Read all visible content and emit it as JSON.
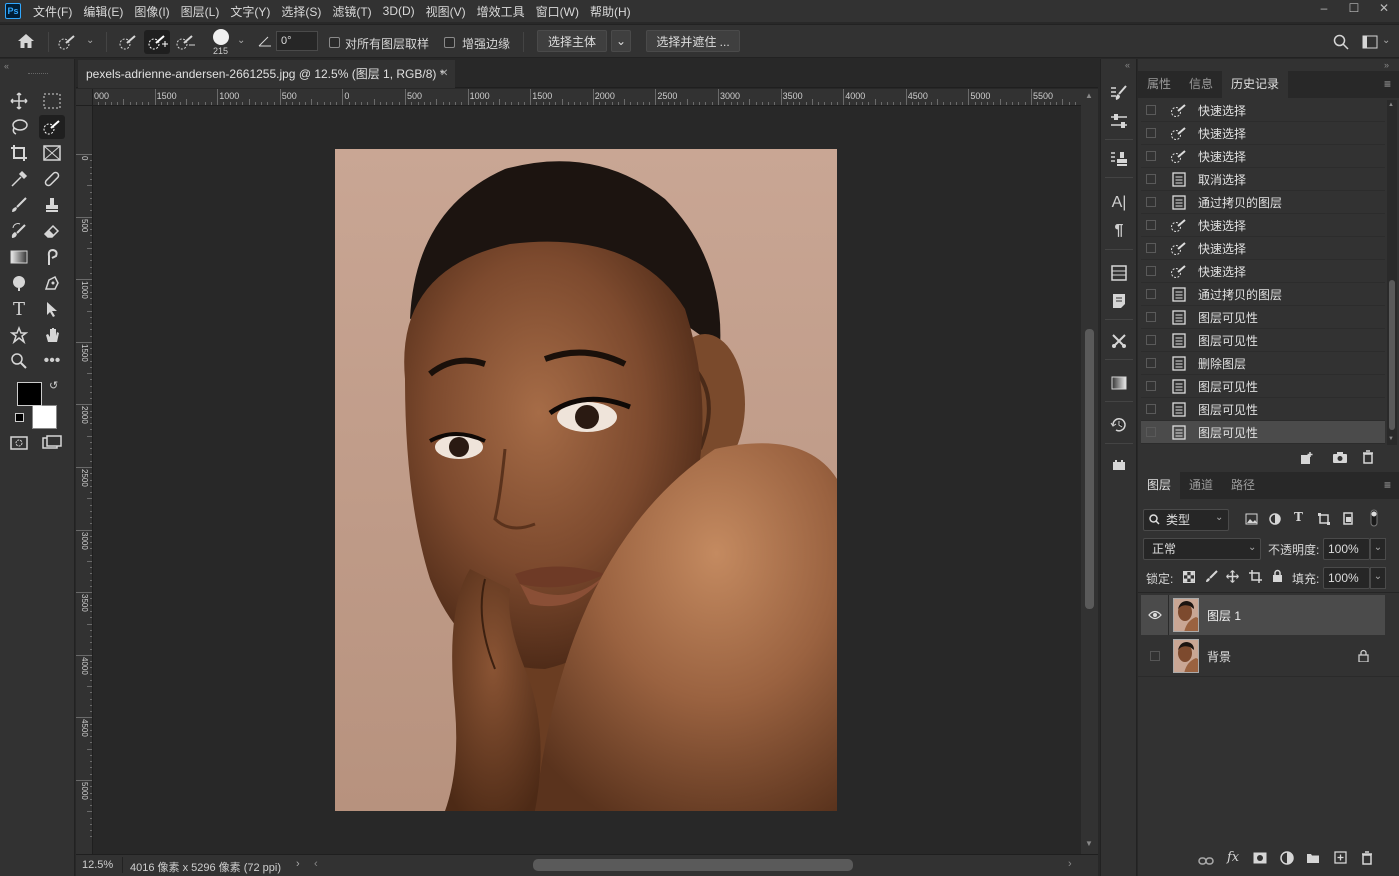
{
  "app": {
    "logo": "Ps"
  },
  "menu": [
    "文件(F)",
    "编辑(E)",
    "图像(I)",
    "图层(L)",
    "文字(Y)",
    "选择(S)",
    "滤镜(T)",
    "3D(D)",
    "视图(V)",
    "增效工具",
    "窗口(W)",
    "帮助(H)"
  ],
  "window_controls": {
    "minimize": "–",
    "maximize": "☐",
    "close": "✕"
  },
  "options": {
    "brush_size": "215",
    "angle": "0°",
    "sample_all_layers": "对所有图层取样",
    "enhance_edge": "增强边缘",
    "select_subject": "选择主体",
    "select_and_mask": "选择并遮住 ..."
  },
  "document": {
    "tab_title": "pexels-adrienne-andersen-2661255.jpg @ 12.5% (图层 1, RGB/8) *",
    "zoom": "12.5%",
    "dimensions": "4016 像素 x 5296 像素 (72 ppi)"
  },
  "ruler_top": [
    "000",
    "1500",
    "1000",
    "500",
    "0",
    "500",
    "1000",
    "1500",
    "2000",
    "2500",
    "3000",
    "3500",
    "4000",
    "4500",
    "5000",
    "5500"
  ],
  "ruler_left": [
    "0",
    "500",
    "1000",
    "1500",
    "2000",
    "2500",
    "3000",
    "3500",
    "4000",
    "4500",
    "5000"
  ],
  "history_panel": {
    "tabs": [
      "属性",
      "信息",
      "历史记录"
    ],
    "items": [
      {
        "label": "快速选择",
        "icon": "quick-select"
      },
      {
        "label": "快速选择",
        "icon": "quick-select"
      },
      {
        "label": "快速选择",
        "icon": "quick-select"
      },
      {
        "label": "取消选择",
        "icon": "document"
      },
      {
        "label": "通过拷贝的图层",
        "icon": "document"
      },
      {
        "label": "快速选择",
        "icon": "quick-select"
      },
      {
        "label": "快速选择",
        "icon": "quick-select"
      },
      {
        "label": "快速选择",
        "icon": "quick-select"
      },
      {
        "label": "通过拷贝的图层",
        "icon": "document"
      },
      {
        "label": "图层可见性",
        "icon": "document"
      },
      {
        "label": "图层可见性",
        "icon": "document"
      },
      {
        "label": "删除图层",
        "icon": "document"
      },
      {
        "label": "图层可见性",
        "icon": "document"
      },
      {
        "label": "图层可见性",
        "icon": "document"
      },
      {
        "label": "图层可见性",
        "icon": "document"
      }
    ]
  },
  "layers_panel": {
    "tabs": [
      "图层",
      "通道",
      "路径"
    ],
    "filter_kind": "类型",
    "blend_mode": "正常",
    "opacity_label": "不透明度:",
    "opacity": "100%",
    "lock_label": "锁定:",
    "fill_label": "填充:",
    "fill": "100%",
    "layers": [
      {
        "name": "图层 1",
        "visible": true,
        "selected": true,
        "locked": false
      },
      {
        "name": "背景",
        "visible": false,
        "selected": false,
        "locked": true
      }
    ]
  },
  "colors": {
    "foreground": "#000000",
    "background": "#ffffff",
    "skin": "#8a5a3c",
    "backdrop": "#c8a490"
  }
}
